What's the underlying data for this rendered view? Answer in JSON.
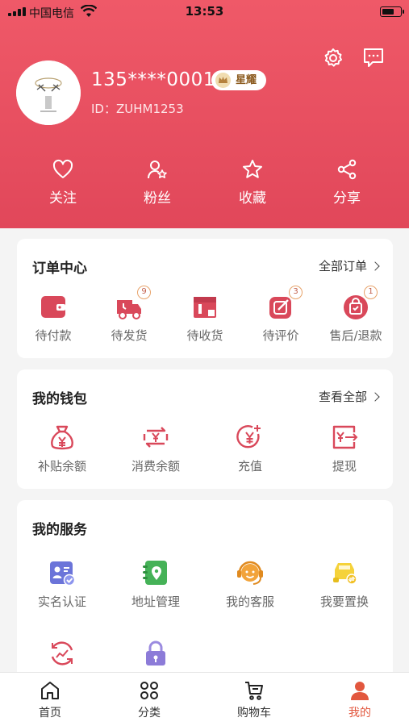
{
  "status_bar": {
    "carrier": "中国电信",
    "time": "13:53"
  },
  "header": {
    "user_name": "135****0001",
    "vip_label": "星耀",
    "user_id": "ID：ZUHM1253"
  },
  "quick_links": [
    {
      "label": "关注",
      "icon": "heart-icon"
    },
    {
      "label": "粉丝",
      "icon": "fans-icon"
    },
    {
      "label": "收藏",
      "icon": "star-icon"
    },
    {
      "label": "分享",
      "icon": "share-icon"
    }
  ],
  "orders": {
    "title": "订单中心",
    "more": "全部订单",
    "items": [
      {
        "label": "待付款",
        "icon": "wallet-icon"
      },
      {
        "label": "待发货",
        "icon": "delivery-truck-icon",
        "badge": "9"
      },
      {
        "label": "待收货",
        "icon": "package-icon"
      },
      {
        "label": "待评价",
        "icon": "review-edit-icon",
        "badge": "3"
      },
      {
        "label": "售后/退款",
        "icon": "after-sale-bag-icon",
        "badge": "1"
      }
    ]
  },
  "wallet": {
    "title": "我的钱包",
    "more": "查看全部",
    "items": [
      {
        "label": "补贴余额",
        "icon": "money-bag-icon"
      },
      {
        "label": "消费余额",
        "icon": "exchange-yuan-icon"
      },
      {
        "label": "充值",
        "icon": "recharge-icon"
      },
      {
        "label": "提现",
        "icon": "withdraw-icon"
      }
    ]
  },
  "services": {
    "title": "我的服务",
    "items": [
      {
        "label": "实名认证",
        "icon": "id-verify-icon"
      },
      {
        "label": "地址管理",
        "icon": "address-book-icon"
      },
      {
        "label": "我的客服",
        "icon": "customer-service-icon"
      },
      {
        "label": "我要置换",
        "icon": "car-swap-icon"
      },
      {
        "label": "",
        "icon": "refresh-chart-icon"
      },
      {
        "label": "",
        "icon": "lock-icon"
      }
    ]
  },
  "tabbar": [
    {
      "label": "首页",
      "icon": "home-icon"
    },
    {
      "label": "分类",
      "icon": "category-grid-icon"
    },
    {
      "label": "购物车",
      "icon": "cart-icon"
    },
    {
      "label": "我的",
      "icon": "profile-icon",
      "active": true
    }
  ],
  "colors": {
    "brand": "#e54b5e",
    "accent_icon": "#d9485a",
    "active_tab": "#e2573e"
  }
}
